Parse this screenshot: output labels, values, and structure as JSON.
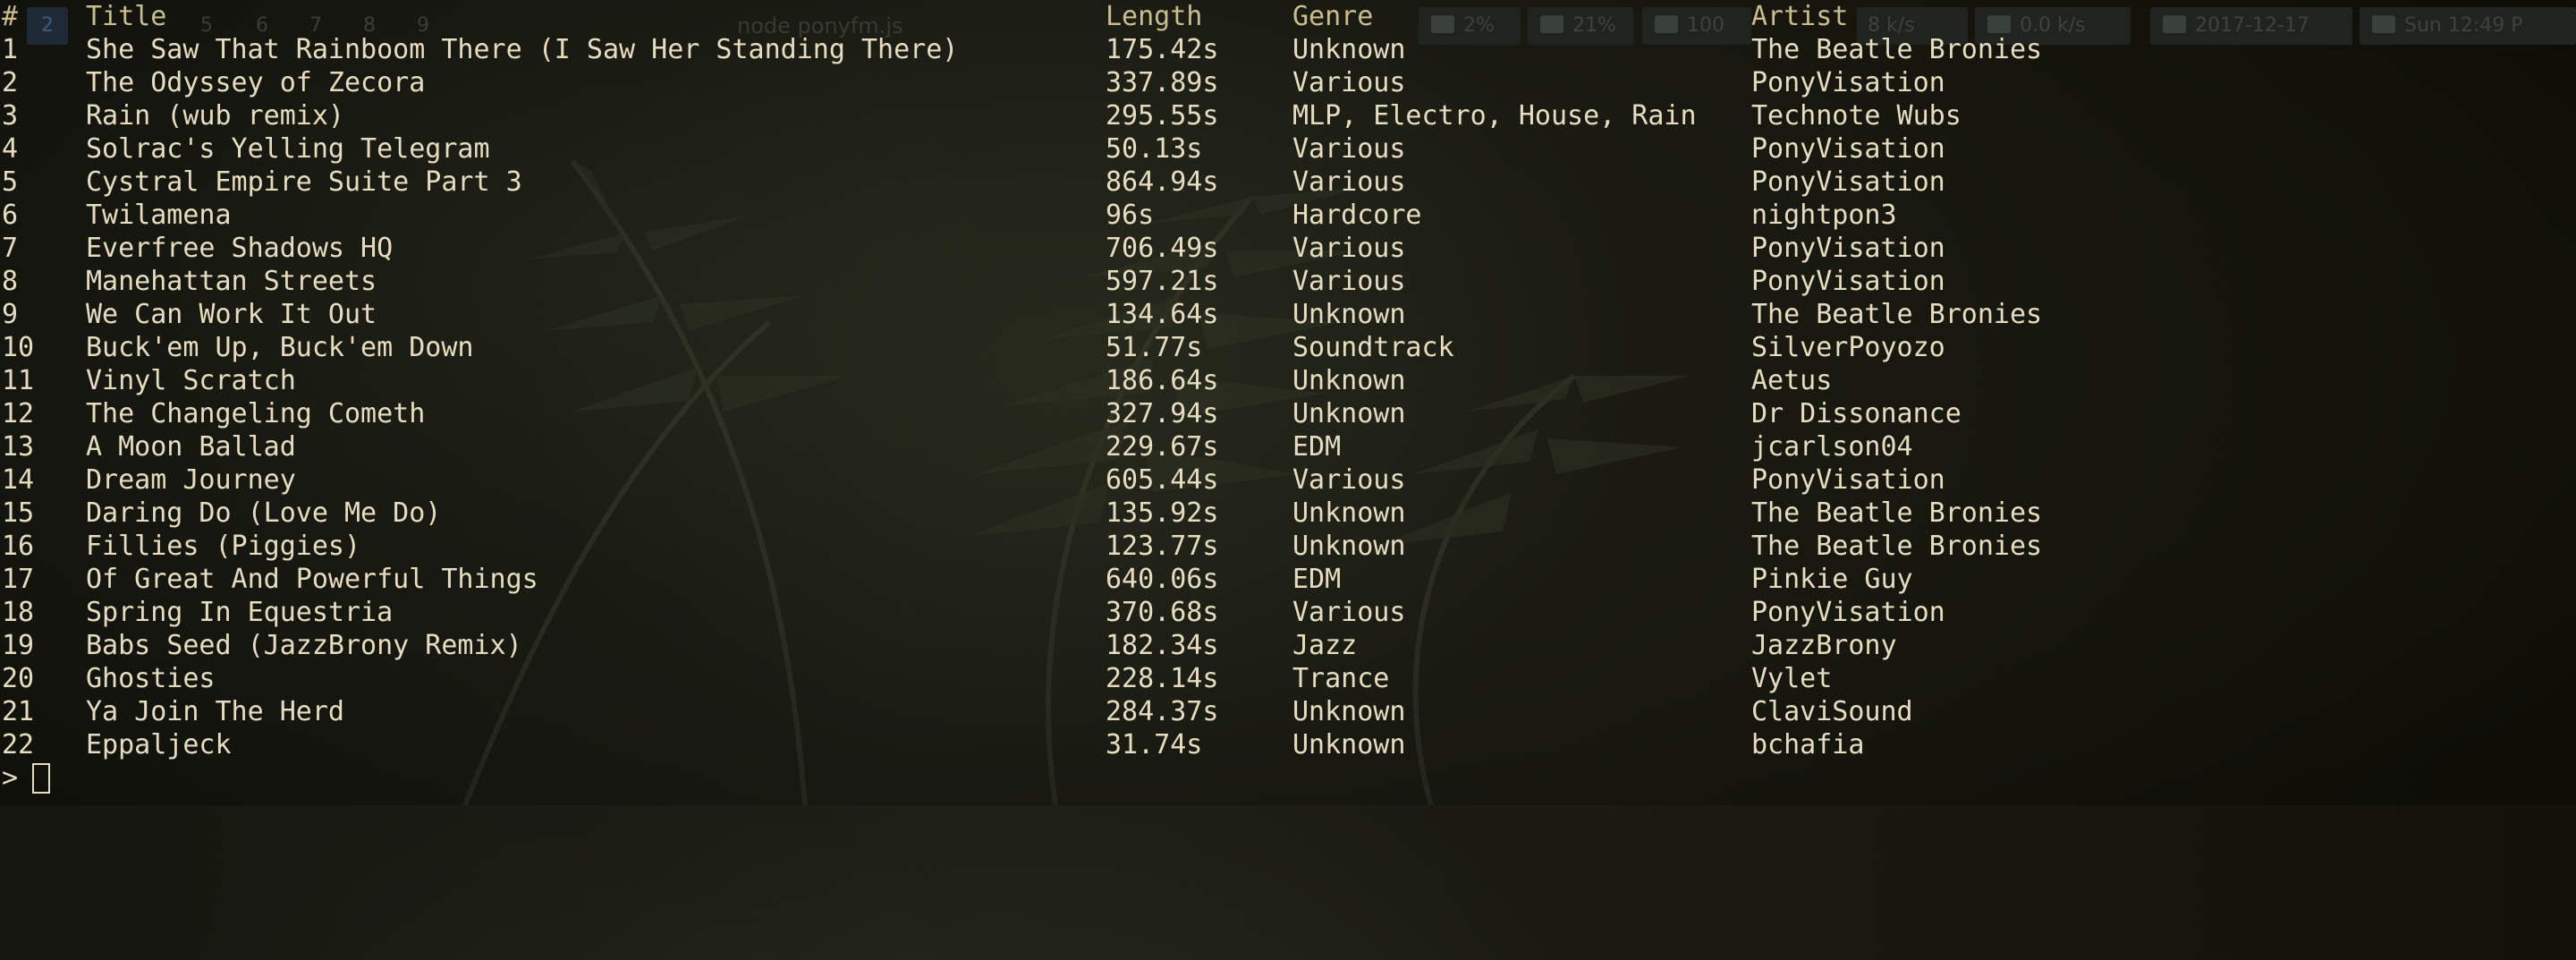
{
  "statusbar": {
    "workspaces": [
      "2",
      "5",
      "6",
      "7",
      "8",
      "9"
    ],
    "active_workspace": "2",
    "window_title": "node ponyfm.js",
    "widgets": [
      {
        "icon": "cpu-icon",
        "text": "2%"
      },
      {
        "icon": "database-icon",
        "text": "21%"
      },
      {
        "icon": "battery-icon",
        "text": "100"
      },
      {
        "icon": "download-icon",
        "text": "8 k/s"
      },
      {
        "icon": "upload-icon",
        "text": "0.0 k/s"
      },
      {
        "icon": "calendar-icon",
        "text": "2017-12-17"
      },
      {
        "icon": "clock-icon",
        "text": "Sun 12:49 P"
      }
    ]
  },
  "table": {
    "headers": {
      "index": "#",
      "title": "Title",
      "length": "Length",
      "genre": "Genre",
      "artist": "Artist"
    },
    "rows": [
      {
        "index": "1",
        "title": "She Saw That Rainboom There (I Saw Her Standing There)",
        "length": "175.42s",
        "genre": "Unknown",
        "artist": "The Beatle Bronies"
      },
      {
        "index": "2",
        "title": "The Odyssey of Zecora",
        "length": "337.89s",
        "genre": "Various",
        "artist": "PonyVisation"
      },
      {
        "index": "3",
        "title": "Rain (wub remix)",
        "length": "295.55s",
        "genre": "MLP, Electro, House, Rain",
        "artist": "Technote Wubs"
      },
      {
        "index": "4",
        "title": "Solrac's Yelling Telegram",
        "length": "50.13s",
        "genre": "Various",
        "artist": "PonyVisation"
      },
      {
        "index": "5",
        "title": "Cystral Empire Suite Part 3",
        "length": "864.94s",
        "genre": "Various",
        "artist": "PonyVisation"
      },
      {
        "index": "6",
        "title": "Twilamena",
        "length": "96s",
        "genre": "Hardcore",
        "artist": "nightpon3"
      },
      {
        "index": "7",
        "title": "Everfree Shadows HQ",
        "length": "706.49s",
        "genre": "Various",
        "artist": "PonyVisation"
      },
      {
        "index": "8",
        "title": "Manehattan Streets",
        "length": "597.21s",
        "genre": "Various",
        "artist": "PonyVisation"
      },
      {
        "index": "9",
        "title": "We Can Work It Out",
        "length": "134.64s",
        "genre": "Unknown",
        "artist": "The Beatle Bronies"
      },
      {
        "index": "10",
        "title": "Buck'em Up, Buck'em Down",
        "length": "51.77s",
        "genre": "Soundtrack",
        "artist": "SilverPoyozo"
      },
      {
        "index": "11",
        "title": "Vinyl Scratch",
        "length": "186.64s",
        "genre": "Unknown",
        "artist": "Aetus"
      },
      {
        "index": "12",
        "title": "The Changeling Cometh",
        "length": "327.94s",
        "genre": "Unknown",
        "artist": "Dr Dissonance"
      },
      {
        "index": "13",
        "title": "A Moon Ballad",
        "length": "229.67s",
        "genre": "EDM",
        "artist": "jcarlson04"
      },
      {
        "index": "14",
        "title": "Dream Journey",
        "length": "605.44s",
        "genre": "Various",
        "artist": "PonyVisation"
      },
      {
        "index": "15",
        "title": "Daring Do (Love Me Do)",
        "length": "135.92s",
        "genre": "Unknown",
        "artist": "The Beatle Bronies"
      },
      {
        "index": "16",
        "title": "Fillies (Piggies)",
        "length": "123.77s",
        "genre": "Unknown",
        "artist": "The Beatle Bronies"
      },
      {
        "index": "17",
        "title": "Of Great And Powerful Things",
        "length": "640.06s",
        "genre": "EDM",
        "artist": "Pinkie Guy"
      },
      {
        "index": "18",
        "title": "Spring In Equestria",
        "length": "370.68s",
        "genre": "Various",
        "artist": "PonyVisation"
      },
      {
        "index": "19",
        "title": "Babs Seed (JazzBrony Remix)",
        "length": "182.34s",
        "genre": "Jazz",
        "artist": "JazzBrony"
      },
      {
        "index": "20",
        "title": "Ghosties",
        "length": "228.14s",
        "genre": "Trance",
        "artist": "Vylet"
      },
      {
        "index": "21",
        "title": "Ya Join The Herd",
        "length": "284.37s",
        "genre": "Unknown",
        "artist": "ClaviSound"
      },
      {
        "index": "22",
        "title": "Eppaljeck",
        "length": "31.74s",
        "genre": "Unknown",
        "artist": "bchafia"
      }
    ]
  },
  "prompt": {
    "symbol": ">",
    "value": ""
  },
  "colors": {
    "text": "#e6dcc0",
    "header_text": "#c9bc8f",
    "background": "#1a1a12",
    "statusbar_widget": "#20241f",
    "active_workspace": "#1e2a35"
  }
}
